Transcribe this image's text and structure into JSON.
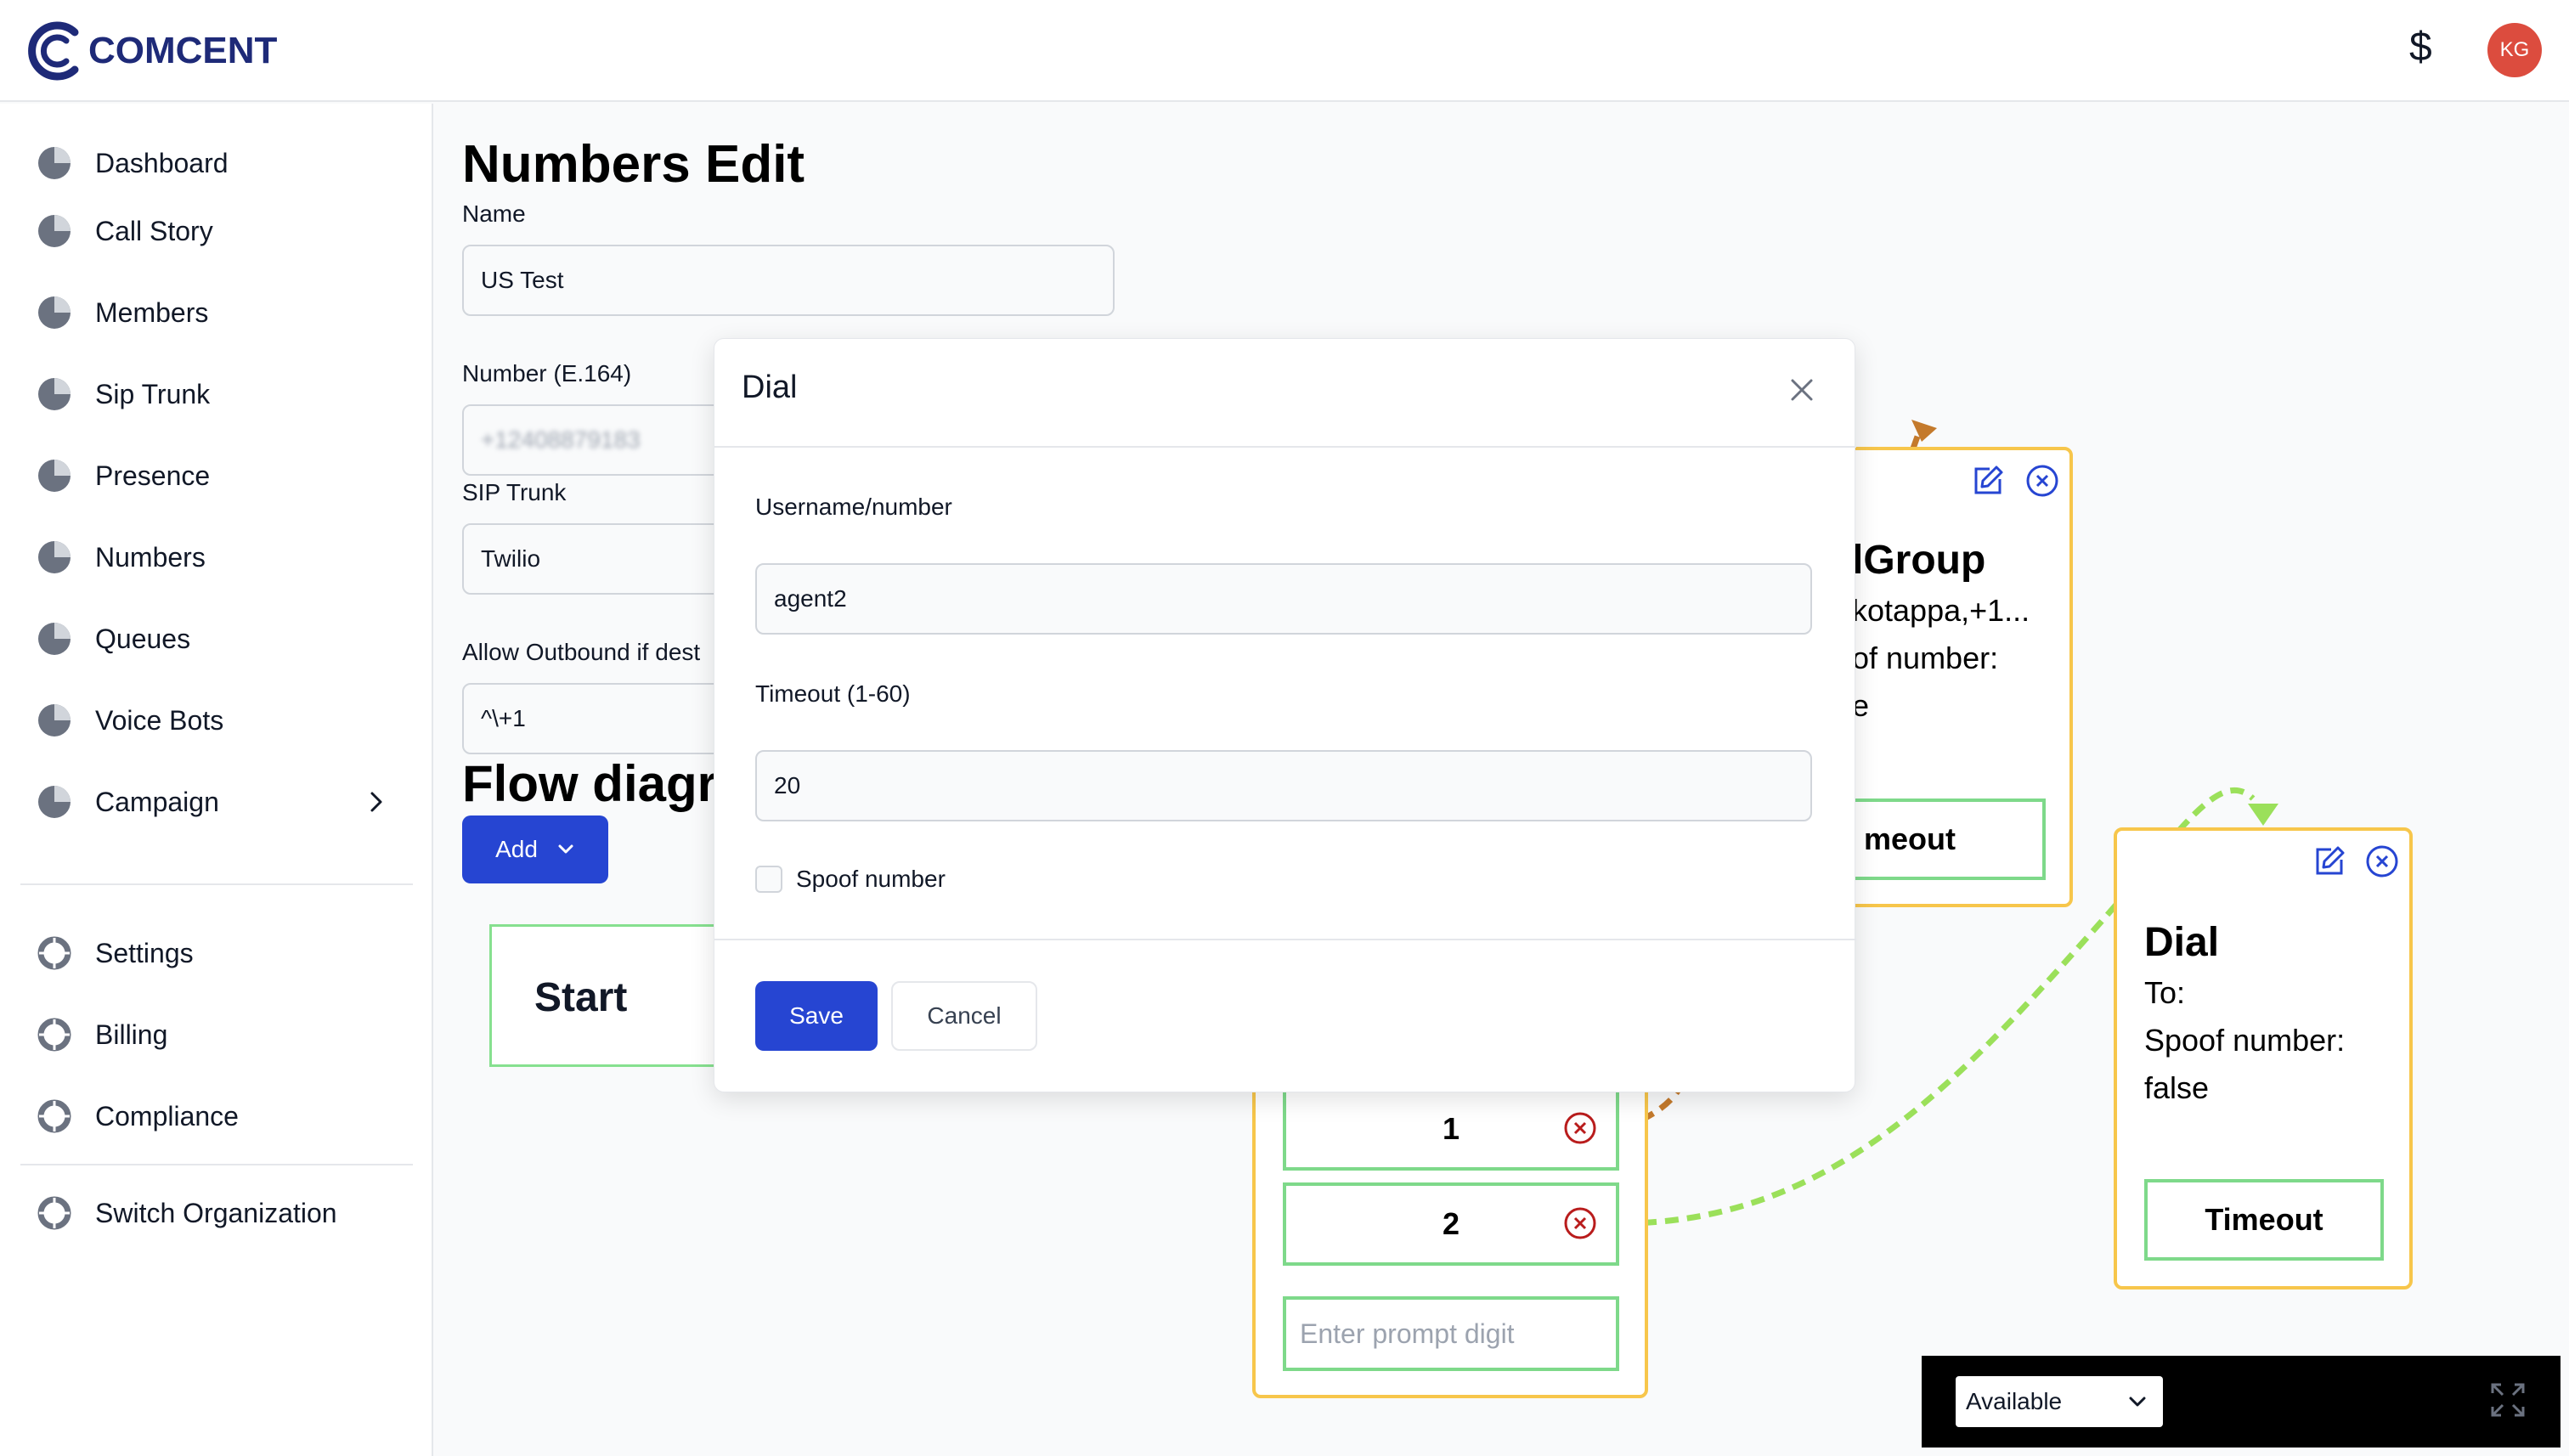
{
  "brand": {
    "name": "COMCENT"
  },
  "header": {
    "currency_symbol": "$",
    "avatar_initials": "KG"
  },
  "sidebar": {
    "items": [
      {
        "label": "Dashboard",
        "icon": "pie-chart-icon"
      },
      {
        "label": "Call Story",
        "icon": "pie-chart-icon"
      },
      {
        "label": "Members",
        "icon": "pie-chart-icon"
      },
      {
        "label": "Sip Trunk",
        "icon": "pie-chart-icon"
      },
      {
        "label": "Presence",
        "icon": "pie-chart-icon"
      },
      {
        "label": "Numbers",
        "icon": "pie-chart-icon"
      },
      {
        "label": "Queues",
        "icon": "pie-chart-icon"
      },
      {
        "label": "Voice Bots",
        "icon": "pie-chart-icon"
      },
      {
        "label": "Campaign",
        "icon": "pie-chart-icon"
      }
    ],
    "settings_items": [
      {
        "label": "Settings",
        "icon": "lifebuoy-icon"
      },
      {
        "label": "Billing",
        "icon": "lifebuoy-icon"
      },
      {
        "label": "Compliance",
        "icon": "lifebuoy-icon"
      }
    ],
    "org_item": {
      "label": "Switch Organization",
      "icon": "lifebuoy-icon"
    }
  },
  "main": {
    "title": "Numbers Edit",
    "name_label": "Name",
    "name_value": "US Test",
    "number_label": "Number (E.164)",
    "number_value": "+12408879183",
    "sip_trunk_label": "SIP Trunk",
    "sip_trunk_value": "Twilio",
    "allow_outbound_label": "Allow Outbound if dest",
    "allow_outbound_value": "^\\+1",
    "flow_title": "Flow diagra",
    "add_button": "Add"
  },
  "flow": {
    "start_label": "Start",
    "dial_group": {
      "title": "lGroup",
      "line1": "kotappa,+1...",
      "line2": "of number:",
      "line3": "e",
      "timeout_label": "meout"
    },
    "menu": {
      "option1": "1",
      "option2": "2",
      "prompt_placeholder": "Enter prompt digit"
    },
    "dial": {
      "title": "Dial",
      "to_label": "To:",
      "spoof_label": "Spoof number:",
      "spoof_value": "false",
      "timeout_label": "Timeout"
    }
  },
  "modal": {
    "title": "Dial",
    "username_label": "Username/number",
    "username_value": "agent2",
    "timeout_label": "Timeout (1-60)",
    "timeout_value": "20",
    "spoof_label": "Spoof number",
    "save_label": "Save",
    "cancel_label": "Cancel"
  },
  "status_widget": {
    "selected": "Available"
  },
  "colors": {
    "brand": "#1e2a78",
    "primary": "#2645d2",
    "avatar": "#dc4c3e",
    "node_border_orange": "#f7c64b",
    "node_border_green": "#7ed98a",
    "edge_brown": "#c47a2c",
    "edge_green": "#9be05a",
    "danger": "#b91c1c"
  }
}
